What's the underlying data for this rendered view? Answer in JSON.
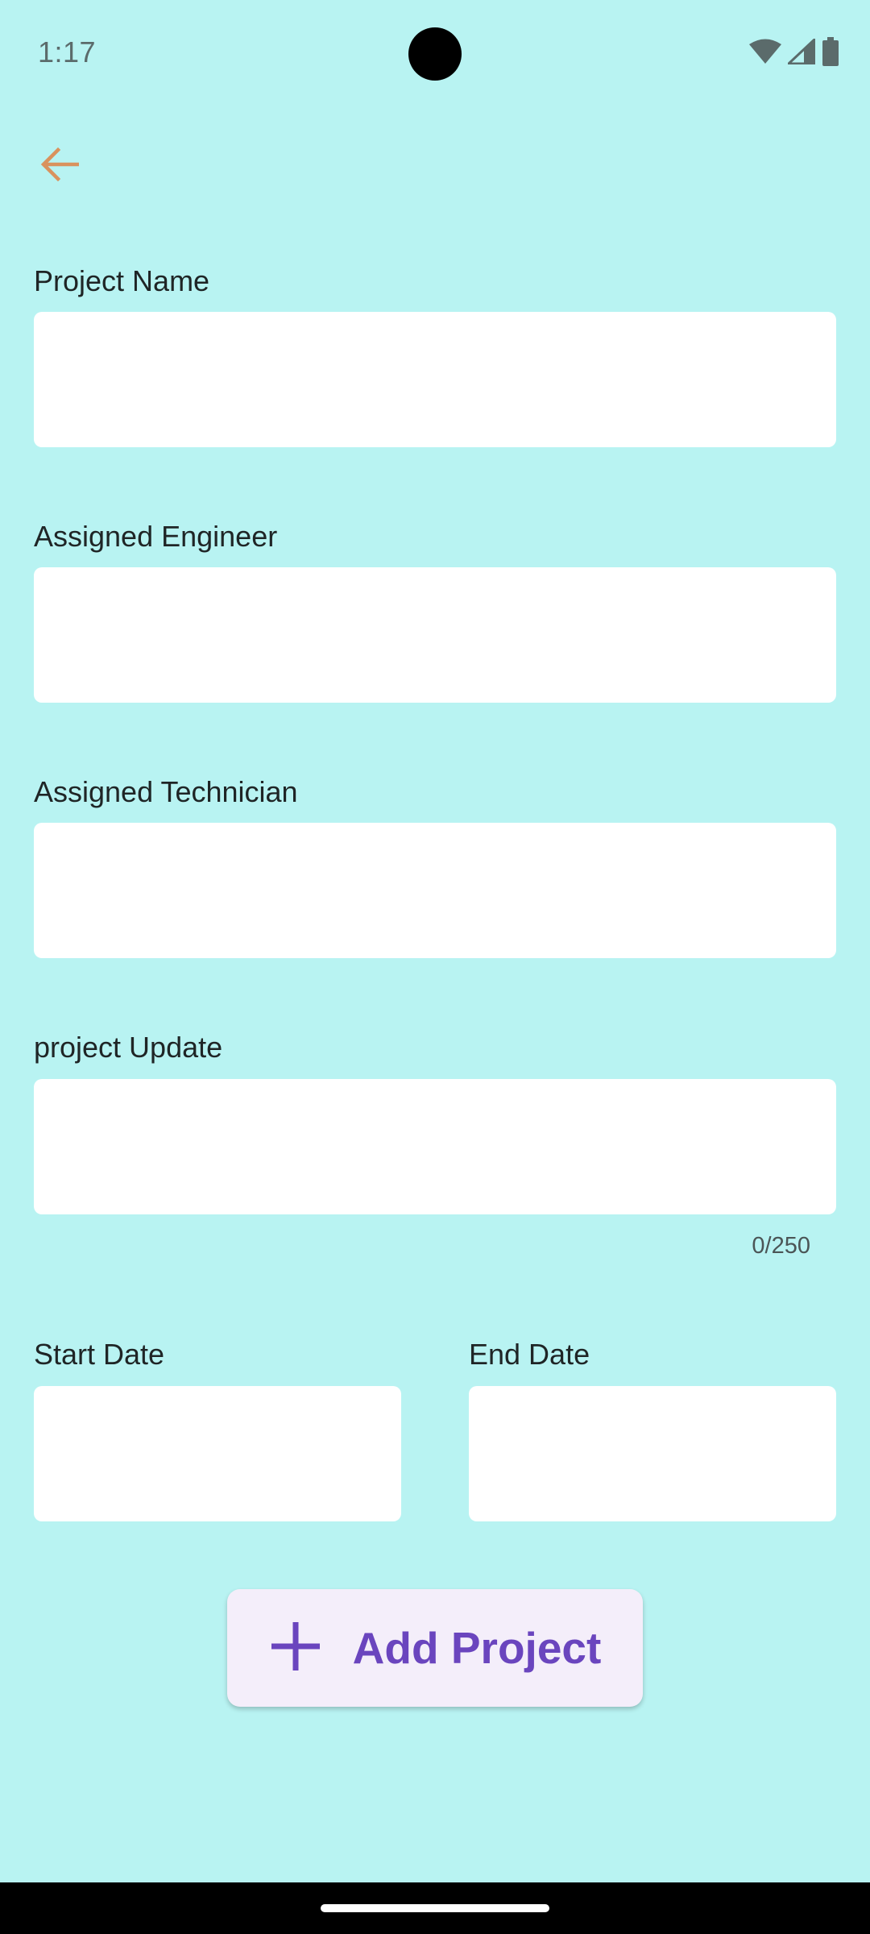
{
  "status_bar": {
    "time": "1:17",
    "icons": [
      "wifi-icon",
      "cell-signal-icon",
      "battery-icon"
    ]
  },
  "header": {
    "back_icon": "arrow-left-icon",
    "back_color": "#d9925d"
  },
  "form": {
    "project_name": {
      "label": "Project Name",
      "value": ""
    },
    "assigned_engineer": {
      "label": "Assigned Engineer",
      "value": ""
    },
    "assigned_technician": {
      "label": "Assigned Technician",
      "value": ""
    },
    "project_update": {
      "label": "project Update",
      "value": "",
      "counter": "0/250"
    },
    "start_date": {
      "label": "Start Date",
      "value": ""
    },
    "end_date": {
      "label": "End Date",
      "value": ""
    }
  },
  "add_button": {
    "label": "Add Project",
    "icon": "plus-icon",
    "color": "#6a45be",
    "background": "#f4eefa"
  },
  "colors": {
    "background": "#b8f3f2",
    "field": "#ffffff"
  }
}
